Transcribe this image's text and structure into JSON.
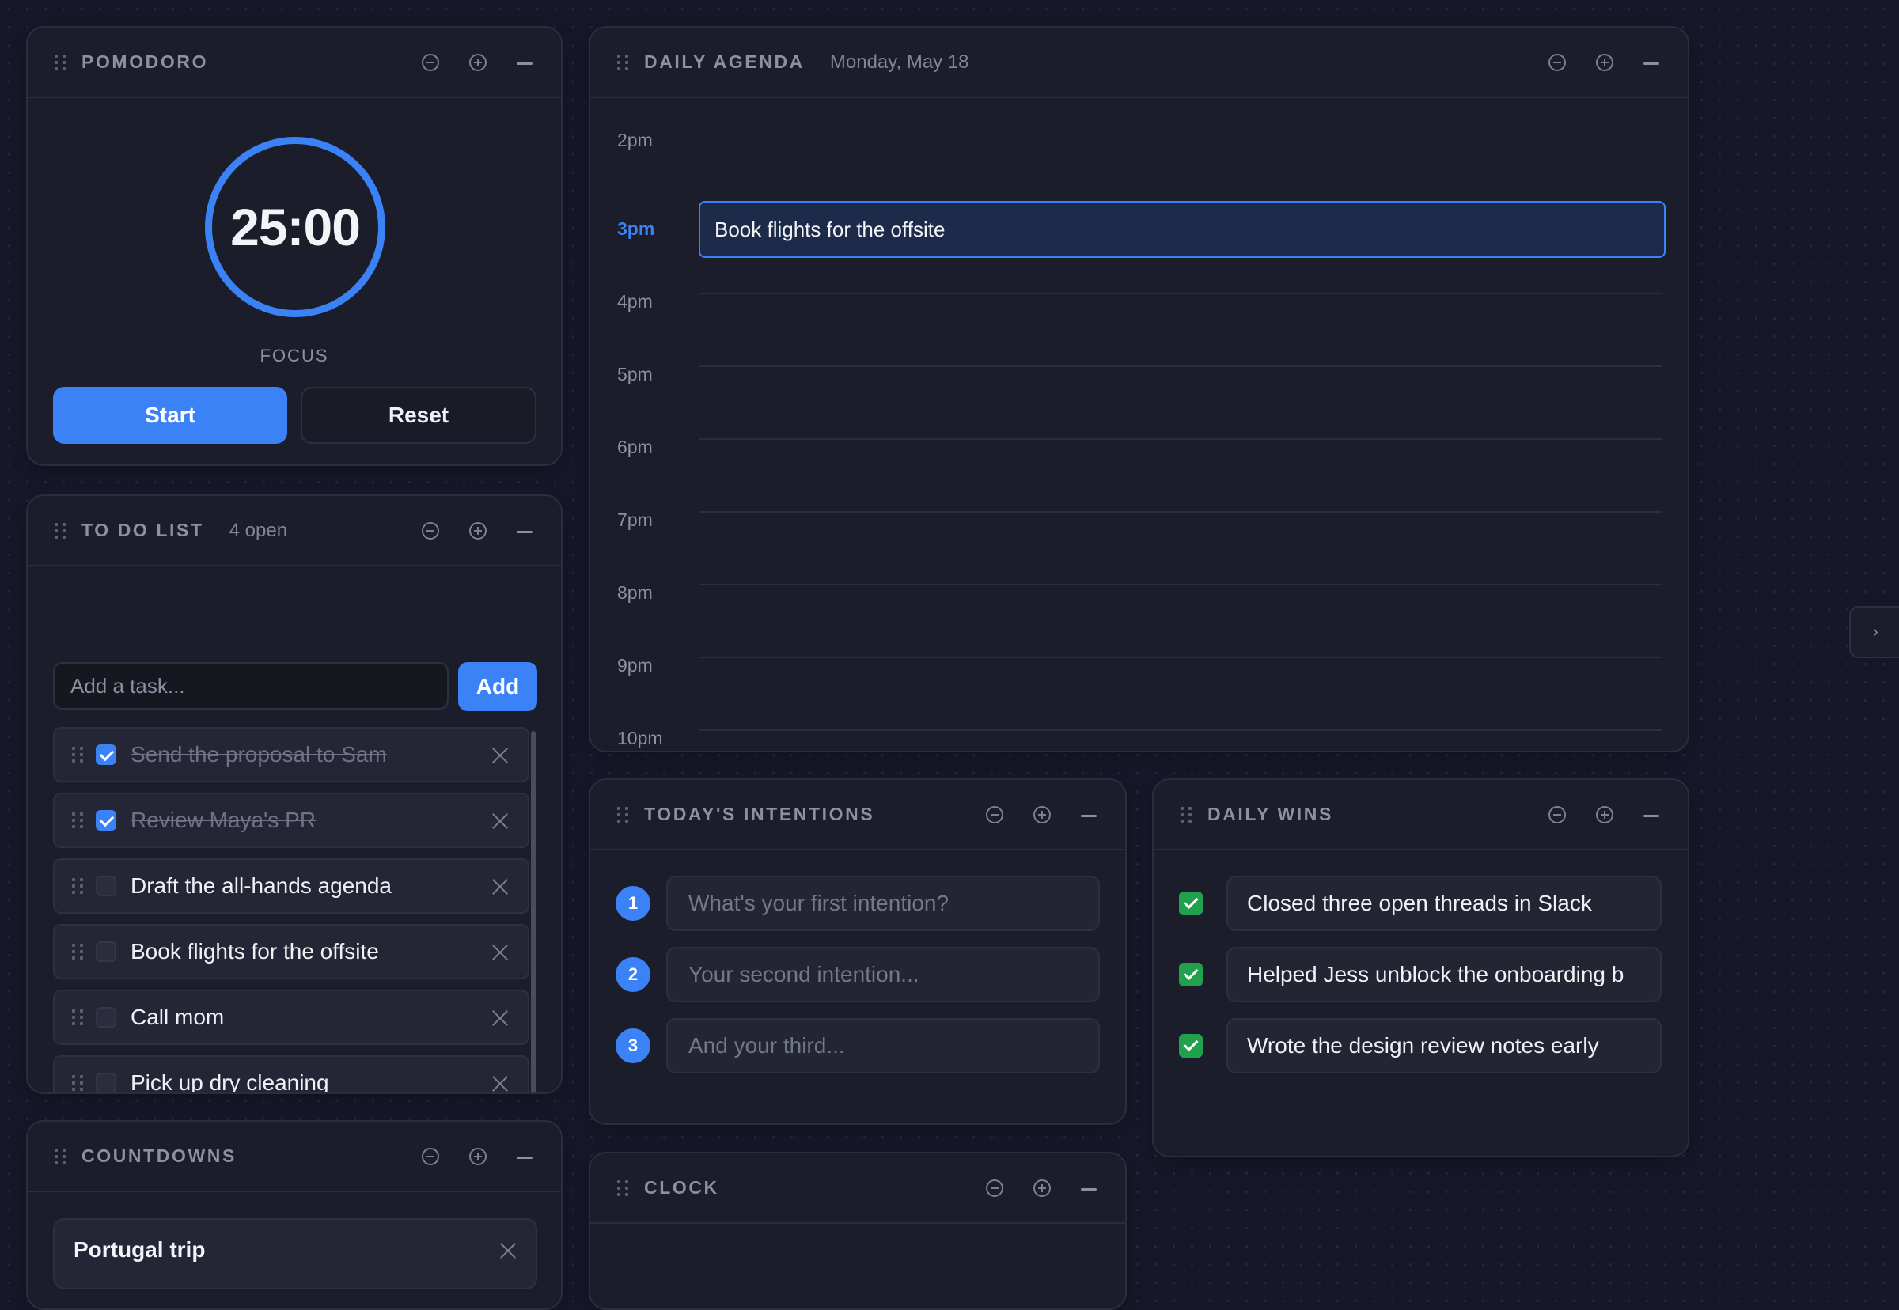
{
  "pomodoro": {
    "title": "POMODORO",
    "time": "25:00",
    "mode": "FOCUS",
    "start_label": "Start",
    "reset_label": "Reset"
  },
  "todo": {
    "title": "TO DO LIST",
    "count": "4 open",
    "placeholder": "Add a task...",
    "add_label": "Add",
    "items": [
      {
        "text": "Send the proposal to Sam",
        "done": true
      },
      {
        "text": "Review Maya's PR",
        "done": true
      },
      {
        "text": "Draft the all-hands agenda",
        "done": false
      },
      {
        "text": "Book flights for the offsite",
        "done": false
      },
      {
        "text": "Call mom",
        "done": false
      },
      {
        "text": "Pick up dry cleaning",
        "done": false
      }
    ]
  },
  "agenda": {
    "title": "DAILY AGENDA",
    "date": "Monday, May 18",
    "hours": [
      "2pm",
      "3pm",
      "4pm",
      "5pm",
      "6pm",
      "7pm",
      "8pm",
      "9pm",
      "10pm"
    ],
    "current_hour": "3pm",
    "event": "Book flights for the offsite"
  },
  "intentions": {
    "title": "TODAY'S INTENTIONS",
    "items": [
      {
        "num": "1",
        "placeholder": "What's your first intention?"
      },
      {
        "num": "2",
        "placeholder": "Your second intention..."
      },
      {
        "num": "3",
        "placeholder": "And your third..."
      }
    ]
  },
  "wins": {
    "title": "DAILY WINS",
    "items": [
      "Closed three open threads in Slack",
      "Helped Jess unblock the onboarding b",
      "Wrote the design review notes early"
    ]
  },
  "countdowns": {
    "title": "COUNTDOWNS",
    "items": [
      "Portugal trip"
    ]
  },
  "clock": {
    "title": "CLOCK"
  },
  "side_tab": {
    "glyph": "›"
  },
  "colors": {
    "accent": "#3b82f6",
    "success": "#22a14c",
    "panel": "#1c1d2b",
    "background": "#17172a"
  },
  "icons": [
    "drag-handle-icon",
    "zoom-out-icon",
    "zoom-in-icon",
    "minimize-icon",
    "checkbox-icon",
    "close-icon",
    "check-icon",
    "chevron-right-icon"
  ]
}
